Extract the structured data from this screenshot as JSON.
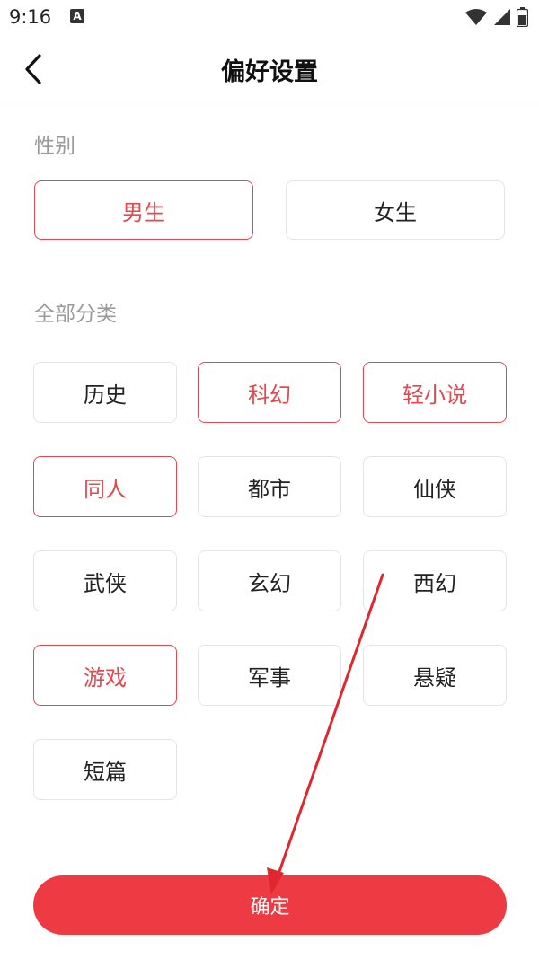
{
  "status_bar": {
    "time": "9:16",
    "notification_letter": "A",
    "icons": [
      "wifi-icon",
      "signal-icon",
      "battery-icon"
    ]
  },
  "header": {
    "title": "偏好设置",
    "back_icon": "chevron-left-icon"
  },
  "gender": {
    "label": "性别",
    "options": [
      {
        "label": "男生",
        "selected": true
      },
      {
        "label": "女生",
        "selected": false
      }
    ]
  },
  "categories": {
    "label": "全部分类",
    "items": [
      {
        "label": "历史",
        "selected": false
      },
      {
        "label": "科幻",
        "selected": true
      },
      {
        "label": "轻小说",
        "selected": true
      },
      {
        "label": "同人",
        "selected": true
      },
      {
        "label": "都市",
        "selected": false
      },
      {
        "label": "仙侠",
        "selected": false
      },
      {
        "label": "武侠",
        "selected": false
      },
      {
        "label": "玄幻",
        "selected": false
      },
      {
        "label": "西幻",
        "selected": false
      },
      {
        "label": "游戏",
        "selected": true
      },
      {
        "label": "军事",
        "selected": false
      },
      {
        "label": "悬疑",
        "selected": false
      },
      {
        "label": "短篇",
        "selected": false
      }
    ]
  },
  "confirm_label": "确定",
  "colors": {
    "accent": "#e2484f",
    "button": "#ee3b43",
    "border": "#e4e4e4",
    "section_label": "#9a9a9a"
  }
}
